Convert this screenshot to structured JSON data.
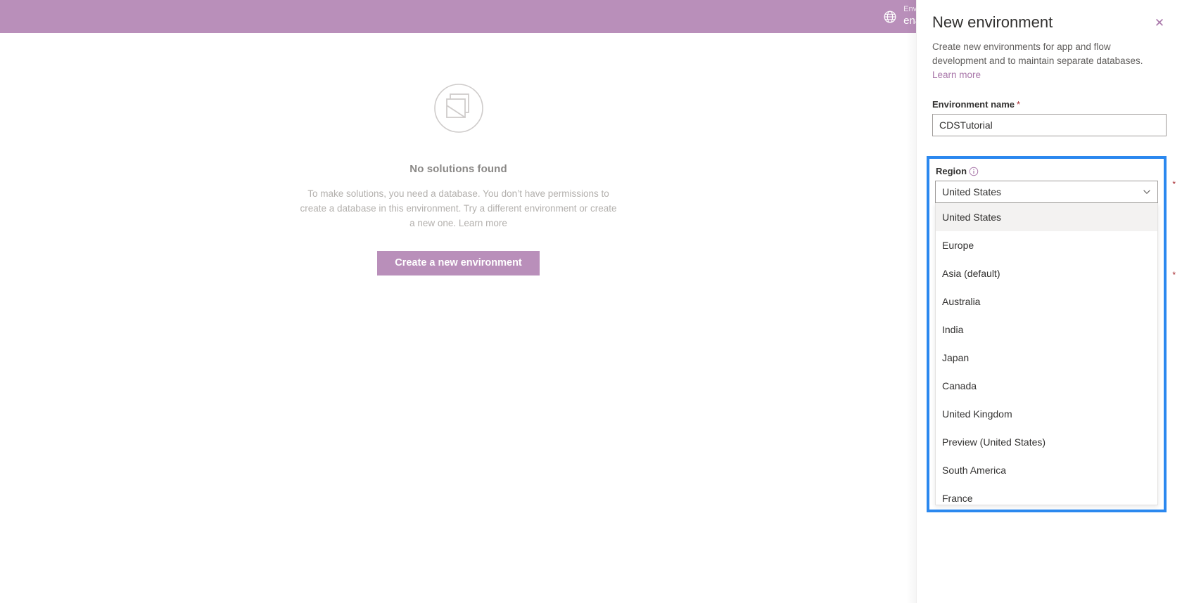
{
  "appbar": {
    "env_icon": "globe-icon",
    "env_label": "Environ",
    "env_value": "enayu"
  },
  "main": {
    "empty_state": {
      "illustration": "no-solutions-illustration",
      "title": "No solutions found",
      "description": "To make solutions, you need a database. You don’t have permissions to create a database in this environment. Try a different environment or create a new one.",
      "learn_more": "Learn more",
      "cta_label": "Create a new environment"
    }
  },
  "panel": {
    "title": "New environment",
    "close_label": "✕",
    "description": "Create new environments for app and flow development and to maintain separate databases.",
    "learn_more": "Learn more",
    "name_field": {
      "label": "Environment name",
      "required_marker": "*",
      "value": "CDSTutorial",
      "placeholder": ""
    },
    "region_field": {
      "label": "Region",
      "info_icon": "info-icon",
      "required_marker": "*",
      "selected": "United States",
      "caret_icon": "chevron-down-icon",
      "options": [
        "United States",
        "Europe",
        "Asia (default)",
        "Australia",
        "India",
        "Japan",
        "Canada",
        "United Kingdom",
        "Preview (United States)",
        "South America",
        "France"
      ]
    },
    "obscured_required_markers": [
      "*",
      "*"
    ]
  },
  "colors": {
    "brand_purple": "#b98fba",
    "focus_blue": "#2b88ef",
    "required_red": "#a4262c",
    "link_purple": "#a977aa"
  }
}
